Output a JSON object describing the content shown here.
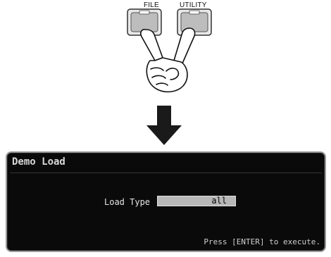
{
  "buttons": {
    "file_label": "FILE",
    "utility_label": "UTILITY"
  },
  "screen": {
    "title": "Demo Load",
    "parameter_label": "Load Type",
    "parameter_value": "all",
    "instruction": "Press [ENTER] to execute."
  },
  "icons": {
    "hand": "two-finger-press-icon",
    "arrow": "arrow-down-icon"
  },
  "colors": {
    "lcd_background": "#0a0a0a",
    "field_background": "#b8b8b8"
  }
}
